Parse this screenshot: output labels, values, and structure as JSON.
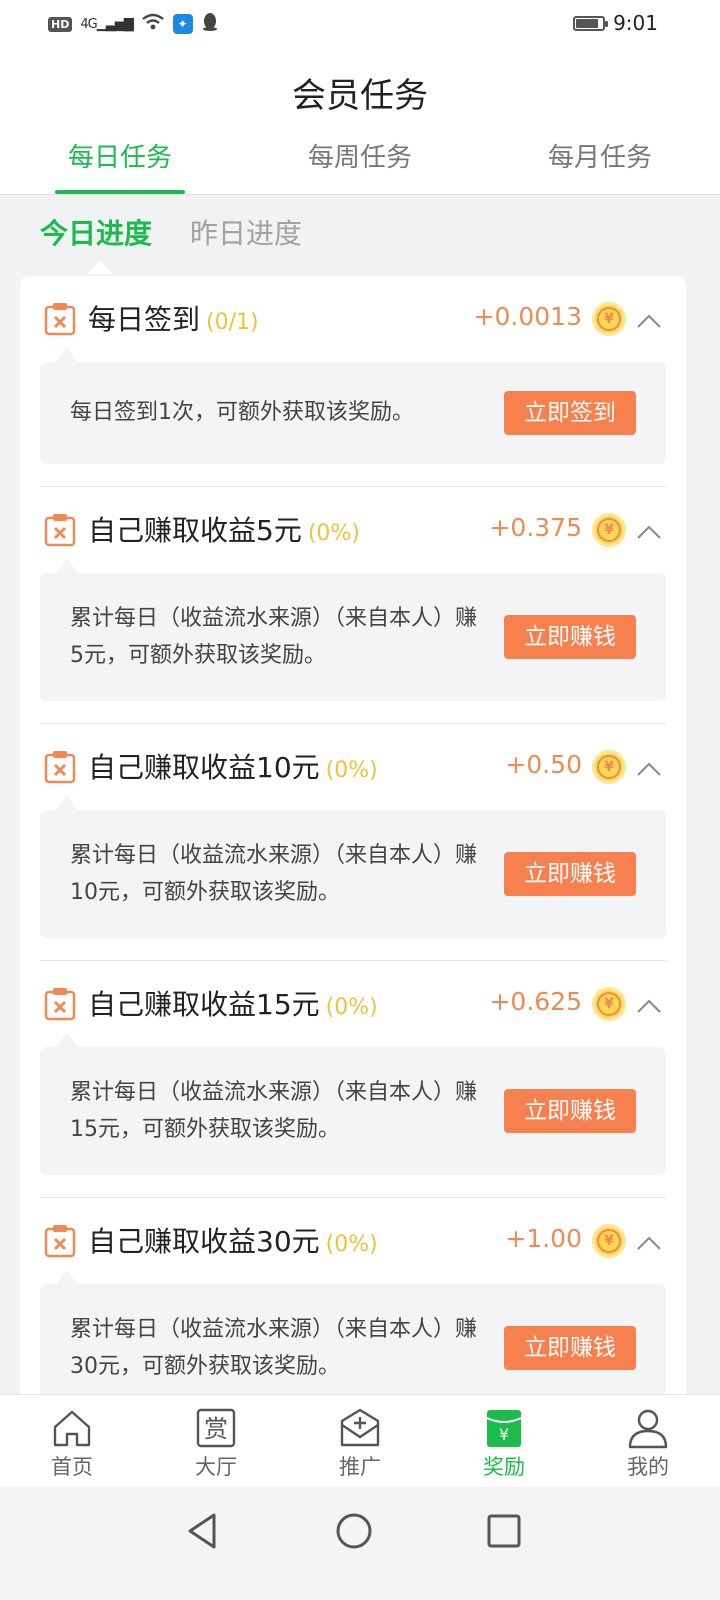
{
  "status": {
    "network": "4G",
    "hd": "HD",
    "time": "9:01",
    "battery_level": 0.85
  },
  "header": {
    "title": "会员任务"
  },
  "tabs": [
    {
      "label": "每日任务",
      "active": true
    },
    {
      "label": "每周任务",
      "active": false
    },
    {
      "label": "每月任务",
      "active": false
    }
  ],
  "subtabs": [
    {
      "label": "今日进度",
      "active": true
    },
    {
      "label": "昨日进度",
      "active": false
    }
  ],
  "tasks": [
    {
      "title": "每日签到",
      "progress": "(0/1)",
      "reward": "+0.0013",
      "desc": "每日签到1次，可额外获取该奖励。",
      "button": "立即签到"
    },
    {
      "title": "自己赚取收益5元",
      "progress": "(0%)",
      "reward": "+0.375",
      "desc": "累计每日（收益流水来源）（来自本人）赚5元，可额外获取该奖励。",
      "button": "立即赚钱"
    },
    {
      "title": "自己赚取收益10元",
      "progress": "(0%)",
      "reward": "+0.50",
      "desc": "累计每日（收益流水来源）（来自本人）赚10元，可额外获取该奖励。",
      "button": "立即赚钱"
    },
    {
      "title": "自己赚取收益15元",
      "progress": "(0%)",
      "reward": "+0.625",
      "desc": "累计每日（收益流水来源）（来自本人）赚15元，可额外获取该奖励。",
      "button": "立即赚钱"
    },
    {
      "title": "自己赚取收益30元",
      "progress": "(0%)",
      "reward": "+1.00",
      "desc": "累计每日（收益流水来源）（来自本人）赚30元，可额外获取该奖励。",
      "button": "立即赚钱"
    }
  ],
  "coin_symbol": "¥",
  "bottom_nav": [
    {
      "label": "首页",
      "icon": "home-icon",
      "active": false
    },
    {
      "label": "大厅",
      "icon": "hall-icon",
      "glyph": "赏",
      "active": false
    },
    {
      "label": "推广",
      "icon": "promote-icon",
      "active": false
    },
    {
      "label": "奖励",
      "icon": "reward-icon",
      "glyph": "¥",
      "active": true
    },
    {
      "label": "我的",
      "icon": "profile-icon",
      "active": false
    }
  ],
  "colors": {
    "accent_green": "#1cbb4b",
    "reward_orange": "#f08a52",
    "button_orange": "#f7804f",
    "progress_yellow": "#efc23b"
  }
}
